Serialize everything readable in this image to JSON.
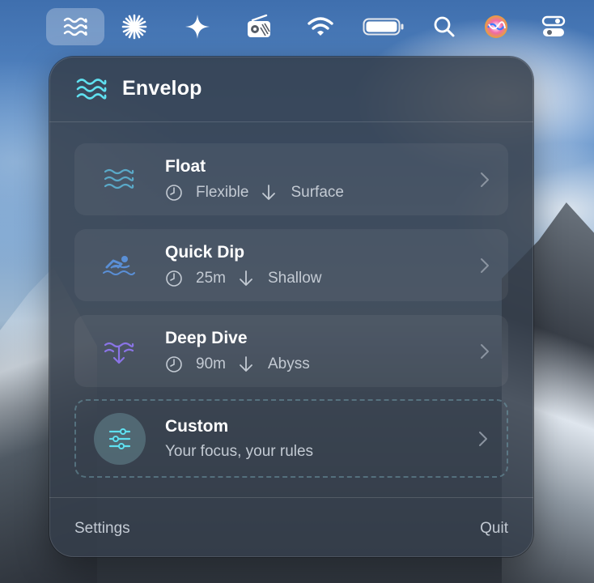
{
  "menubar": {
    "items": [
      {
        "icon": "waves-icon",
        "active": true
      },
      {
        "icon": "asterisk-burst-icon"
      },
      {
        "icon": "sparkle-icon"
      },
      {
        "icon": "radio-icon"
      },
      {
        "icon": "wifi-icon"
      },
      {
        "icon": "battery-icon"
      },
      {
        "icon": "search-icon"
      },
      {
        "icon": "siri-icon"
      },
      {
        "icon": "control-center-icon"
      }
    ]
  },
  "panel": {
    "title": "Envelop",
    "accent_color": "#5fe0f0",
    "modes": [
      {
        "title": "Float",
        "duration": "Flexible",
        "depth": "Surface",
        "icon": "waves-icon",
        "icon_color": "#5aa9c8"
      },
      {
        "title": "Quick Dip",
        "duration": "25m",
        "depth": "Shallow",
        "icon": "swimmer-icon",
        "icon_color": "#5a8fd6"
      },
      {
        "title": "Deep Dive",
        "duration": "90m",
        "depth": "Abyss",
        "icon": "dive-down-icon",
        "icon_color": "#8a74e6"
      }
    ],
    "custom": {
      "title": "Custom",
      "subtitle": "Your focus, your rules",
      "icon": "sliders-icon"
    },
    "footer": {
      "settings_label": "Settings",
      "quit_label": "Quit"
    }
  }
}
